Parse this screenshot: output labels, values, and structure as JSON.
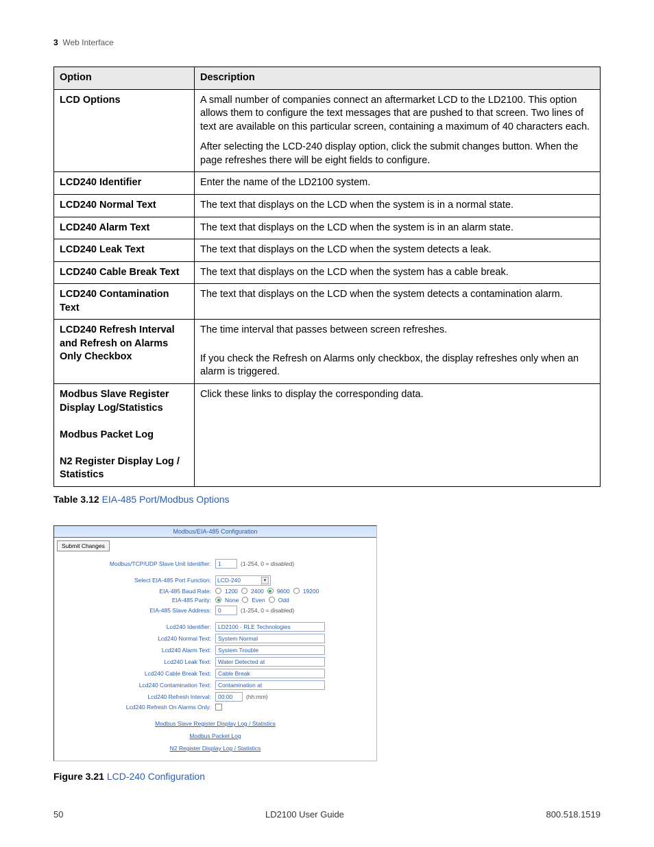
{
  "header": {
    "chapter_num": "3",
    "chapter_title": "Web Interface"
  },
  "table": {
    "head": {
      "c1": "Option",
      "c2": "Description"
    },
    "rows": [
      {
        "opt": "LCD Options",
        "desc": [
          "A small number of companies connect an aftermarket LCD to the LD2100. This option allows them to configure the text messages that are pushed to that screen. Two lines of text are available on this particular screen, containing a maximum of 40 characters each.",
          "After selecting the LCD-240 display option, click the submit changes button. When the page refreshes there will be eight fields to configure."
        ]
      },
      {
        "opt": "LCD240 Identifier",
        "desc": [
          "Enter the name of the LD2100 system."
        ]
      },
      {
        "opt": "LCD240 Normal Text",
        "desc": [
          "The text that displays on the LCD when the system is in a normal state."
        ]
      },
      {
        "opt": "LCD240 Alarm Text",
        "desc": [
          "The text that displays on the LCD when the system is in an alarm state."
        ]
      },
      {
        "opt": "LCD240 Leak Text",
        "desc": [
          "The text that displays on the LCD when the system detects a leak."
        ]
      },
      {
        "opt": "LCD240 Cable Break Text",
        "desc": [
          "The text that displays on the LCD when the system has a cable break."
        ]
      },
      {
        "opt": "LCD240 Contamination Text",
        "desc": [
          "The text that displays on the LCD when the system detects a contamination alarm."
        ]
      },
      {
        "opt": "LCD240 Refresh Interval and Refresh on Alarms Only Checkbox",
        "desc": [
          "The time interval that passes between screen refreshes.",
          "If you check the Refresh on Alarms only checkbox, the display refreshes only when an alarm is triggered."
        ]
      },
      {
        "opt": "Modbus Slave Register Display Log/Statistics\n\nModbus Packet Log\n\nN2 Register Display Log / Statistics",
        "desc": [
          "Click these links to display the corresponding data."
        ]
      }
    ]
  },
  "table_caption": {
    "label": "Table 3.12",
    "text": "EIA-485 Port/Modbus Options"
  },
  "figure": {
    "title": "Modbus/EIA-485 Configuration",
    "submit": "Submit Changes",
    "fields": {
      "f1": {
        "label": "Modbus/TCP/UDP Slave Unit Identifier:",
        "value": "1",
        "suffix": "(1-254, 0 = disabled)"
      },
      "f2": {
        "label": "Select EIA-485 Port Function:",
        "value": "LCD-240"
      },
      "f3": {
        "label": "EIA-485 Baud Rate:",
        "opts": [
          {
            "label": "1200",
            "checked": false
          },
          {
            "label": "2400",
            "checked": false
          },
          {
            "label": "9600",
            "checked": true
          },
          {
            "label": "19200",
            "checked": false
          }
        ]
      },
      "f4": {
        "label": "EIA-485 Parity:",
        "opts": [
          {
            "label": "None",
            "checked": true
          },
          {
            "label": "Even",
            "checked": false
          },
          {
            "label": "Odd",
            "checked": false
          }
        ]
      },
      "f5": {
        "label": "EIA-485 Slave Address:",
        "value": "0",
        "suffix": "(1-254, 0 = disabled)"
      },
      "f6": {
        "label": "Lcd240 Identifier:",
        "value": "LD2100 - RLE Technologies"
      },
      "f7": {
        "label": "Lcd240 Normal Text:",
        "value": "System Normal"
      },
      "f8": {
        "label": "Lcd240 Alarm Text:",
        "value": "System Trouble"
      },
      "f9": {
        "label": "Lcd240 Leak Text:",
        "value": "Water Detected at"
      },
      "f10": {
        "label": "Lcd240 Cable Break Text:",
        "value": "Cable Break"
      },
      "f11": {
        "label": "Lcd240 Contamination Text:",
        "value": "Contamination at"
      },
      "f12": {
        "label": "Lcd240 Refresh Interval:",
        "value": "00:00",
        "suffix": "(hh:mm)"
      },
      "f13": {
        "label": "Lcd240 Refresh On Alarms Only:"
      }
    },
    "links": {
      "l1": "Modbus Slave Register Display Log / Statistics",
      "l2": "Modbus Packet Log",
      "l3": "N2 Register Display Log / Statistics"
    }
  },
  "figure_caption": {
    "label": "Figure 3.21",
    "text": "LCD-240 Configuration"
  },
  "footer": {
    "page": "50",
    "center": "LD2100 User Guide",
    "right": "800.518.1519"
  }
}
